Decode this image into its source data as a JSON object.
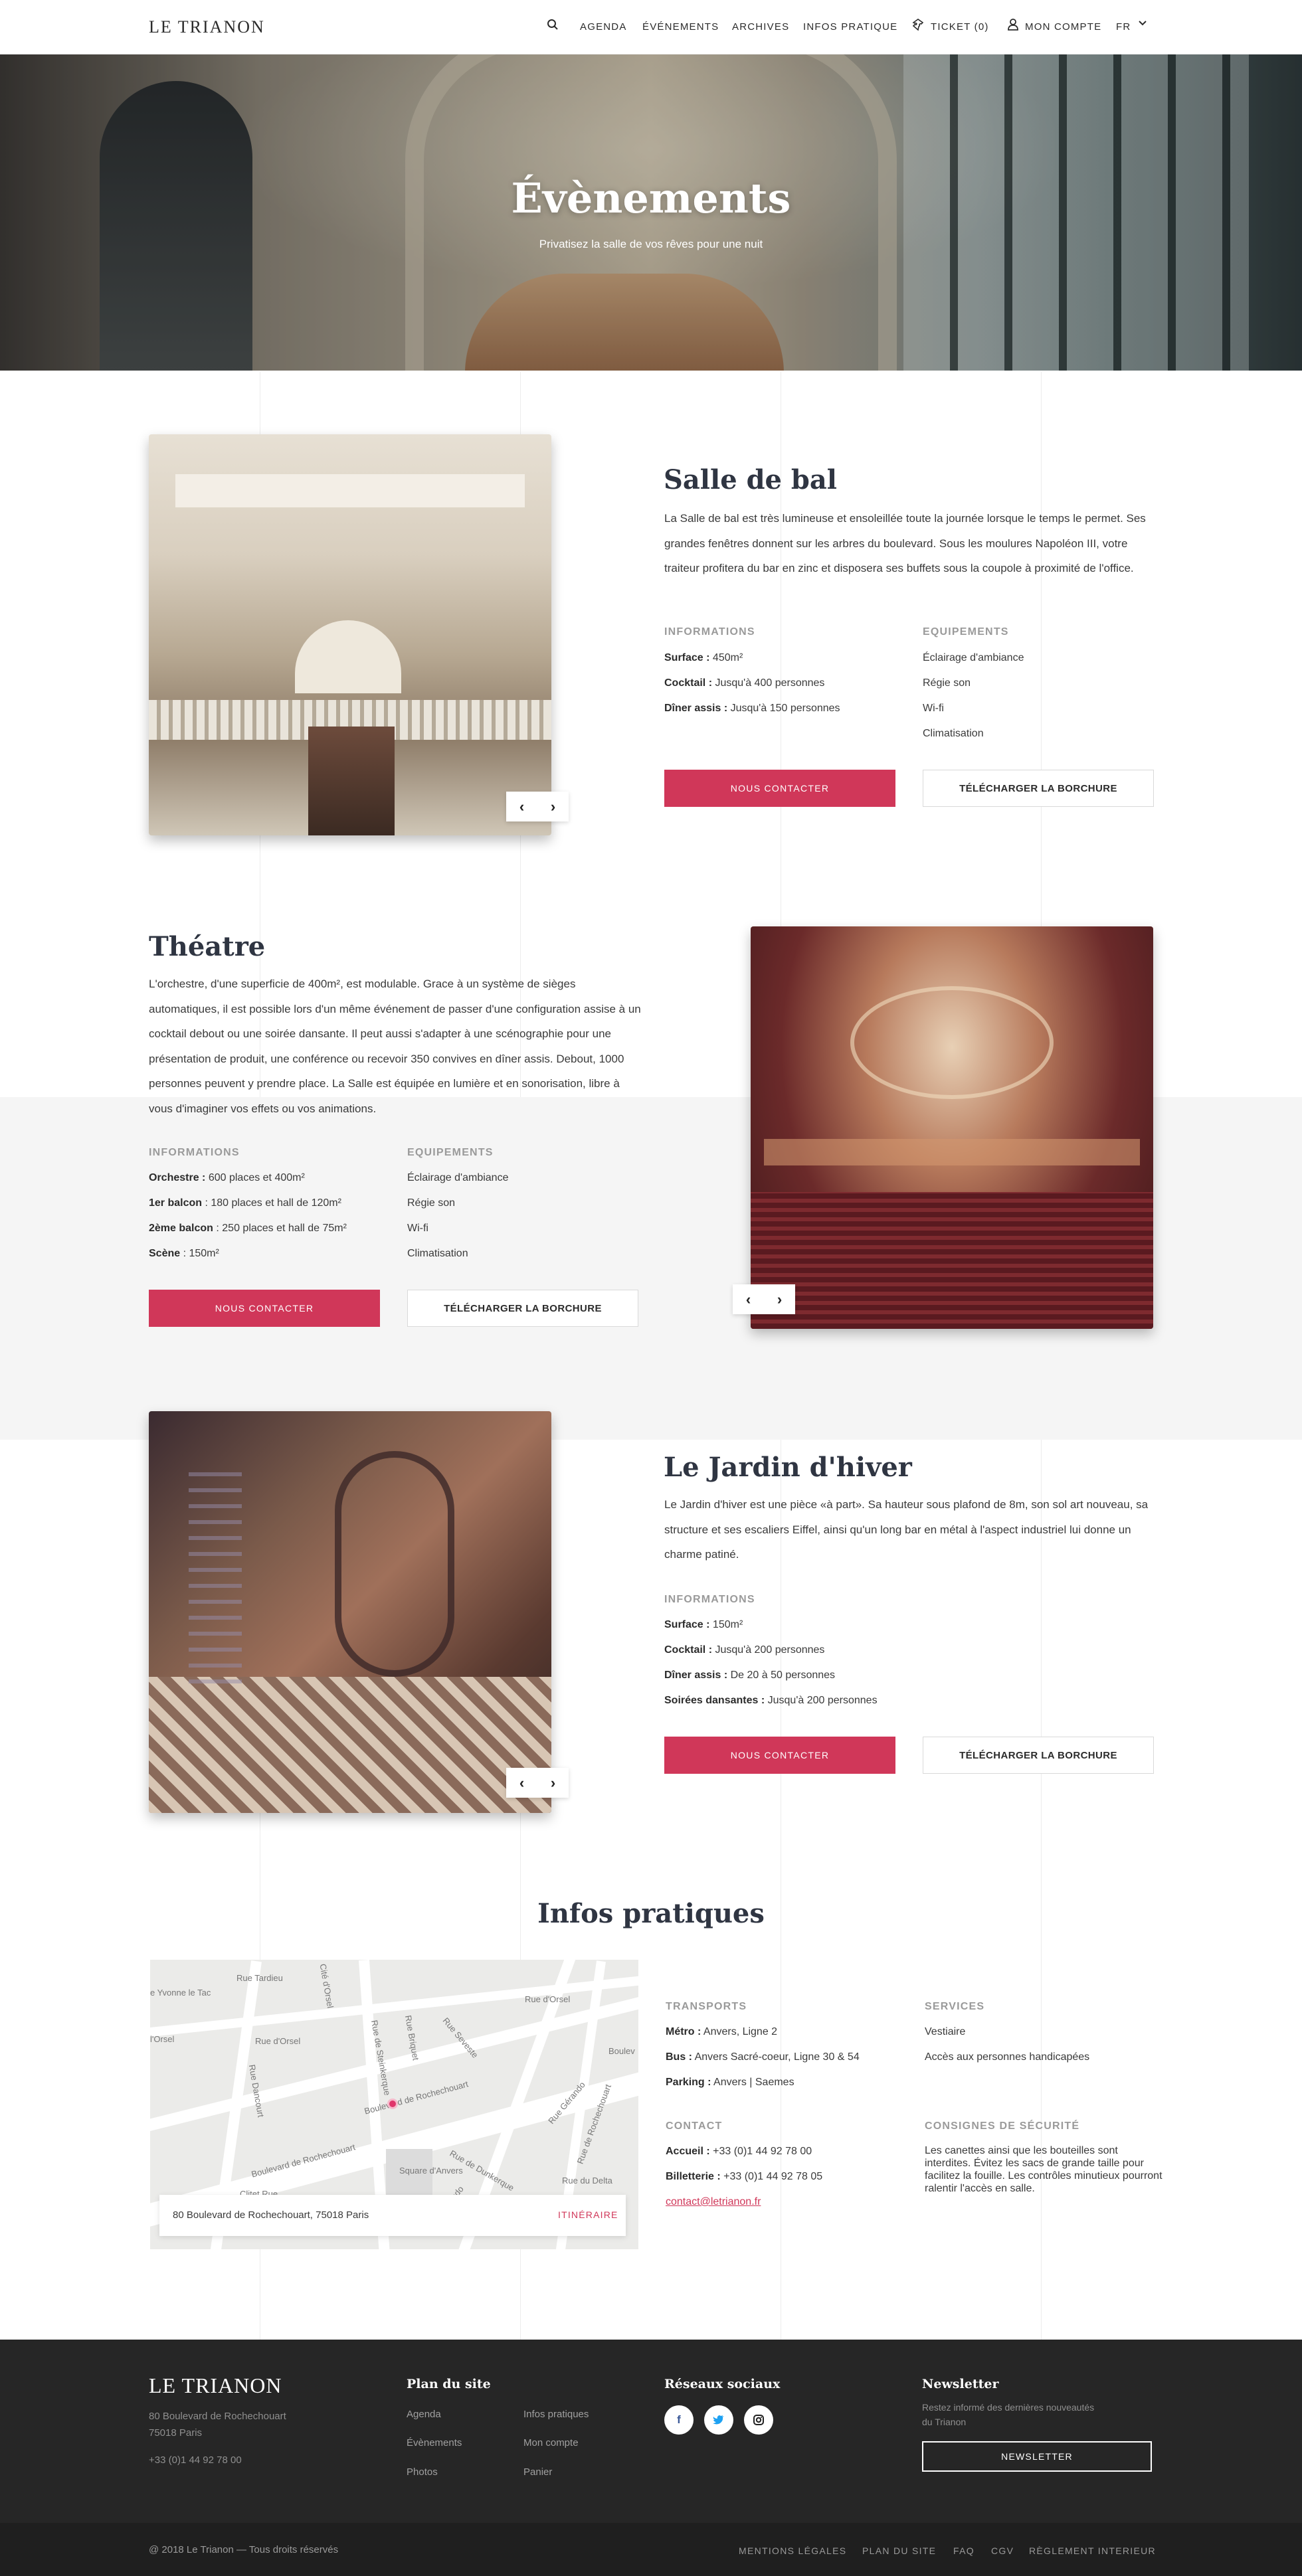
{
  "header": {
    "logo": "LE TRIANON",
    "nav": [
      "AGENDA",
      "ÉVÉNEMENTS",
      "ARCHIVES",
      "INFOS PRATIQUE"
    ],
    "ticket": "TICKET (0)",
    "account": "MON COMPTE",
    "lang": "FR"
  },
  "hero": {
    "title": "Évènements",
    "subtitle": "Privatisez la salle de vos rêves pour une nuit"
  },
  "salle_de_bal": {
    "title": "Salle de bal",
    "description": "La Salle de bal est très lumineuse et ensoleillée toute la journée lorsque le temps le permet. Ses grandes fenêtres donnent sur les arbres du boulevard. Sous les moulures Napoléon III, votre traiteur profitera du bar en zinc et disposera ses buffets sous la coupole à proximité de l'office.",
    "info_label": "INFORMATIONS",
    "info": [
      {
        "k": "Surface :",
        "v": " 450m²"
      },
      {
        "k": "Cocktail :",
        "v": " Jusqu'à 400 personnes"
      },
      {
        "k": "Dîner assis :",
        "v": " Jusqu'à 150 personnes"
      }
    ],
    "equip_label": "EQUIPEMENTS",
    "equip": [
      "Éclairage d'ambiance",
      "Régie son",
      "Wi-fi",
      "Climatisation"
    ],
    "contact": "NOUS CONTACTER",
    "download": "TÉLÉCHARGER LA BORCHURE"
  },
  "theatre": {
    "title": "Théatre",
    "description": "L'orchestre, d'une superficie de 400m², est modulable. Grace à un système de sièges automatiques, il est possible lors d'un même événement de passer d'une configuration assise à un cocktail debout ou une soirée dansante. Il peut aussi s'adapter à une scénographie pour une présentation de produit, une conférence ou recevoir 350 convives en dîner assis. Debout, 1000 personnes peuvent y prendre place. La Salle est équipée en lumière et en sonorisation, libre à vous d'imaginer vos effets ou vos animations.",
    "info_label": "INFORMATIONS",
    "info": [
      {
        "k": "Orchestre :",
        "v": " 600 places et 400m²"
      },
      {
        "k": "1er balcon",
        "v": " : 180 places et hall de 120m²"
      },
      {
        "k": "2ème balcon",
        "v": " : 250 places et hall de 75m²"
      },
      {
        "k": "Scène",
        "v": " : 150m²"
      }
    ],
    "equip_label": "EQUIPEMENTS",
    "equip": [
      "Éclairage d'ambiance",
      "Régie son",
      "Wi-fi",
      "Climatisation"
    ],
    "contact": "NOUS CONTACTER",
    "download": "TÉLÉCHARGER LA BORCHURE"
  },
  "jardin": {
    "title": "Le Jardin d'hiver",
    "description": "Le Jardin d'hiver est une pièce «à part». Sa hauteur sous plafond de 8m, son sol art nouveau, sa structure et ses escaliers Eiffel, ainsi qu'un long bar en métal à l'aspect industriel lui donne un charme patiné.",
    "info_label": "INFORMATIONS",
    "info": [
      {
        "k": "Surface :",
        "v": " 150m²"
      },
      {
        "k": "Cocktail :",
        "v": " Jusqu'à 200 personnes"
      },
      {
        "k": "Dîner assis :",
        "v": " De 20 à 50 personnes"
      },
      {
        "k": "Soirées dansantes :",
        "v": " Jusqu'à 200 personnes"
      }
    ],
    "contact": "NOUS CONTACTER",
    "download": "TÉLÉCHARGER LA BORCHURE"
  },
  "infos": {
    "title": "Infos pratiques",
    "map": {
      "address": "80 Boulevard de Rochechouart, 75018 Paris",
      "itinerary": "ITINÉRAIRE",
      "streets": [
        "Rue Tardieu",
        "e Yvonne le Tac",
        "Cité d'Orsel",
        "Rue d'Orsel",
        "Rue d'Orsel",
        "l'Orsel",
        "Rue de Steinkerque",
        "Rue Briquet",
        "Rue Seveste",
        "Boulev",
        "Rue Dancourt",
        "Boulevard de Rochechouart",
        "Rue Gérando",
        "Rue de Rochechouart",
        "Boulevard de Rochechouart",
        "Rue de Dunkerque",
        "Rue du Delta",
        "Square d'Anvers",
        "Rue Gérando",
        "Clitet Rue"
      ]
    },
    "transports_label": "TRANSPORTS",
    "transports": [
      {
        "k": "Métro :",
        "v": " Anvers, Ligne 2"
      },
      {
        "k": "Bus :",
        "v": " Anvers Sacré-coeur, Ligne 30 & 54"
      },
      {
        "k": "Parking :",
        "v": " Anvers | Saemes"
      }
    ],
    "services_label": "SERVICES",
    "services": [
      "Vestiaire",
      "Accès aux personnes handicapées"
    ],
    "contact_label": "CONTACT",
    "contact": [
      {
        "k": "Accueil :",
        "v": " +33 (0)1 44 92 78 00"
      },
      {
        "k": "Billetterie :",
        "v": " +33 (0)1 44 92 78 05"
      }
    ],
    "email": "contact@letrianon.fr",
    "security_label": "CONSIGNES DE SÉCURITÉ",
    "security": "Les canettes ainsi que les bouteilles sont interdites. Évitez les sacs de grande taille pour facilitez la fouille. Les contrôles minutieux pourront ralentir l'accès en salle."
  },
  "footer": {
    "logo": "LE TRIANON",
    "address1": "80 Boulevard de Rochechouart",
    "address2": "75018 Paris",
    "phone": "+33 (0)1 44 92 78 00",
    "plan_title": "Plan du site",
    "plan_links": [
      "Agenda",
      "Évènements",
      "Photos",
      "Infos pratiques",
      "Mon compte",
      "Panier"
    ],
    "social_title": "Réseaux sociaux",
    "newsletter_title": "Newsletter",
    "newsletter_text1": "Restez informé des dernières nouveautés",
    "newsletter_text2": "du Trianon",
    "newsletter_button": "NEWSLETTER",
    "copyright": "@ 2018 Le Trianon — Tous droits réservés",
    "legal_links": [
      "MENTIONS LÉGALES",
      "PLAN DU SITE",
      "FAQ",
      "CGV",
      "RÈGLEMENT INTERIEUR"
    ]
  }
}
